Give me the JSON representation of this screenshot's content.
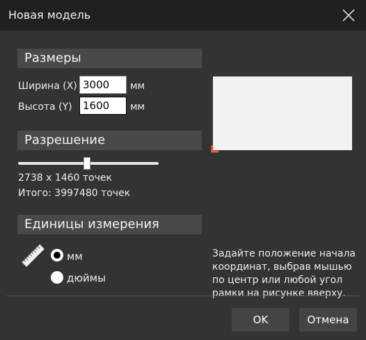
{
  "window": {
    "title": "Новая модель"
  },
  "sizes": {
    "header": "Размеры",
    "width_label": "Ширина (X)",
    "width_value": "3000",
    "width_unit": "мм",
    "height_label": "Высота (Y)",
    "height_value": "1600",
    "height_unit": "мм"
  },
  "resolution": {
    "header": "Разрешение",
    "slider_level": 0.49,
    "pixels_text": "2738 x 1460 точек",
    "total_text": "Итого: 3997480 точек"
  },
  "units": {
    "header": "Единицы измерения",
    "options": [
      {
        "label": "мм",
        "selected": true
      },
      {
        "label": "дюймы",
        "selected": false
      }
    ]
  },
  "hint": {
    "text": "Задайте положение начала координат, выбрав мышью по центр или любой угол рамки на рисунке вверху."
  },
  "buttons": {
    "ok": "OK",
    "cancel": "Отмена"
  },
  "colors": {
    "background": "#333333",
    "titlebar": "#202020",
    "section_header": "#494949",
    "origin_marker": "#e8632b",
    "button": "#444444"
  },
  "icons": {
    "close": "close-icon",
    "ruler": "ruler-icon",
    "origin": "origin-corner-icon"
  }
}
